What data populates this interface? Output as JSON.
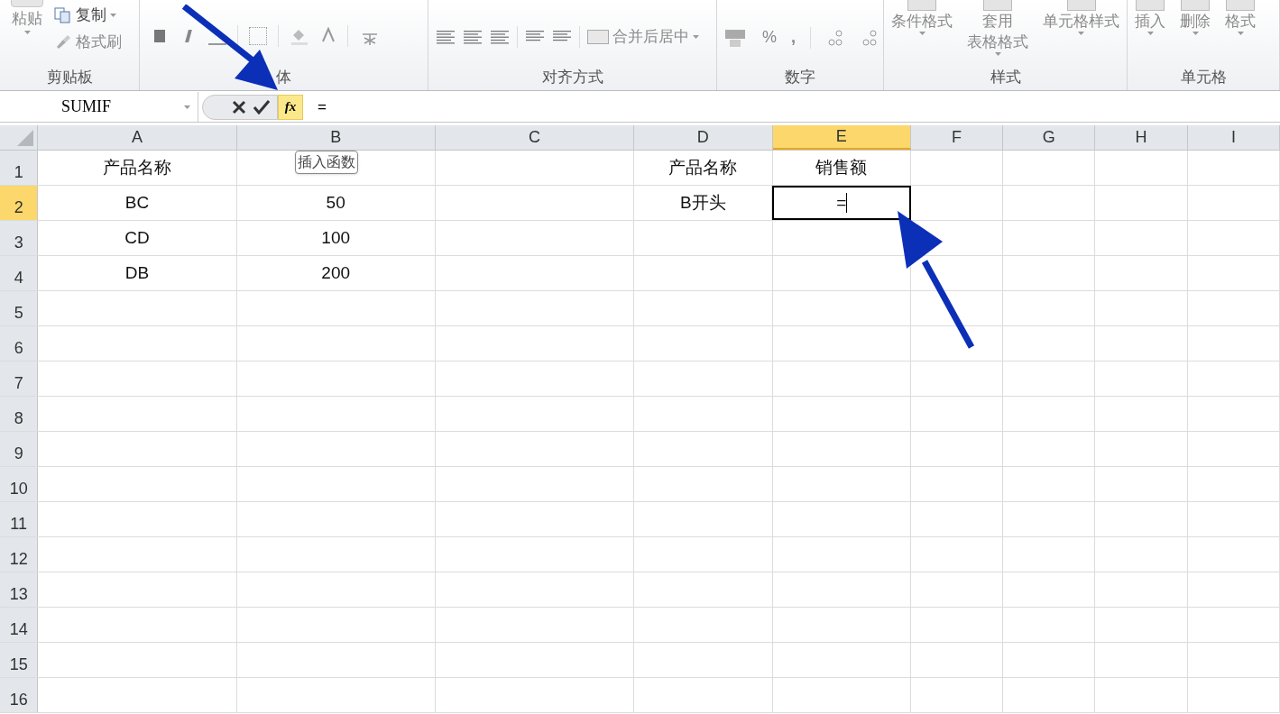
{
  "ribbon": {
    "groups": [
      {
        "kind": "clipboard",
        "label": "剪贴板",
        "paste": "粘贴",
        "copy": "复制",
        "format_painter": "格式刷"
      },
      {
        "kind": "font",
        "label": "体"
      },
      {
        "kind": "alignment",
        "label": "对齐方式",
        "merge": "合并后居中"
      },
      {
        "kind": "number",
        "label": "数字",
        "percent": "%",
        "comma": ","
      },
      {
        "kind": "styles",
        "label": "样式",
        "buttons": [
          {
            "lines": [
              "条件格式"
            ]
          },
          {
            "lines": [
              "套用",
              "表格格式"
            ]
          },
          {
            "lines": [
              "单元格样式"
            ]
          }
        ]
      },
      {
        "kind": "cells",
        "label": "单元格",
        "buttons": [
          {
            "lines": [
              "插入"
            ]
          },
          {
            "lines": [
              "删除"
            ]
          },
          {
            "lines": [
              "格式"
            ]
          }
        ]
      }
    ]
  },
  "formula_bar": {
    "name_box": "SUMIF",
    "insert_function": "fx",
    "formula": "=",
    "tooltip": "插入函数"
  },
  "sheet": {
    "columns": [
      {
        "label": "A",
        "selected": false
      },
      {
        "label": "B",
        "selected": false
      },
      {
        "label": "C",
        "selected": false
      },
      {
        "label": "D",
        "selected": false
      },
      {
        "label": "E",
        "selected": true
      },
      {
        "label": "F",
        "selected": false
      },
      {
        "label": "G",
        "selected": false
      },
      {
        "label": "H",
        "selected": false
      },
      {
        "label": "I",
        "selected": false
      }
    ],
    "rows": [
      {
        "label": "1",
        "selected": false,
        "cells": [
          {
            "text": "产品名称",
            "selected": false
          },
          {
            "selected": false
          },
          {
            "selected": false
          },
          {
            "text": "产品名称",
            "selected": false
          },
          {
            "text": "销售额",
            "selected": false
          }
        ]
      },
      {
        "label": "2",
        "selected": true,
        "cells": [
          {
            "text": "BC",
            "selected": false
          },
          {
            "text": "50",
            "selected": false
          },
          {
            "selected": false
          },
          {
            "text": "B开头",
            "selected": false
          },
          {
            "text": "=",
            "selected": true
          }
        ]
      },
      {
        "label": "3",
        "selected": false,
        "cells": [
          {
            "text": "CD",
            "selected": false
          },
          {
            "text": "100",
            "selected": false
          }
        ]
      },
      {
        "label": "4",
        "selected": false,
        "cells": [
          {
            "text": "DB",
            "selected": false
          },
          {
            "text": "200",
            "selected": false
          }
        ]
      },
      {
        "label": "5",
        "selected": false
      },
      {
        "label": "6",
        "selected": false
      },
      {
        "label": "7",
        "selected": false
      },
      {
        "label": "8",
        "selected": false
      },
      {
        "label": "9",
        "selected": false
      },
      {
        "label": "10",
        "selected": false
      },
      {
        "label": "11",
        "selected": false
      },
      {
        "label": "12",
        "selected": false
      },
      {
        "label": "13",
        "selected": false
      },
      {
        "label": "14",
        "selected": false
      },
      {
        "label": "15",
        "selected": false
      },
      {
        "label": "16",
        "selected": false
      }
    ]
  }
}
